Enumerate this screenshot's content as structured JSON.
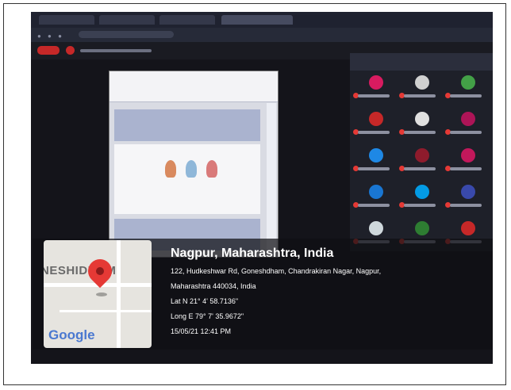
{
  "geotag": {
    "city": "Nagpur, Maharashtra, India",
    "address_line1": "122, Hudkeshwar Rd, Goneshdham, Chandrakiran Nagar, Nagpur,",
    "address_line2": "Maharashtra 440034, India",
    "lat": "Lat N 21° 4' 58.7136\"",
    "long": "Long E 79° 7' 35.9672\"",
    "datetime": "15/05/21 12:41 PM",
    "map_label": "NESHIDHAM",
    "map_brand": "Google"
  },
  "colors": {
    "pin": "#e53935",
    "overlay": "#0f0f14",
    "meeting_bg": "#14141a"
  }
}
